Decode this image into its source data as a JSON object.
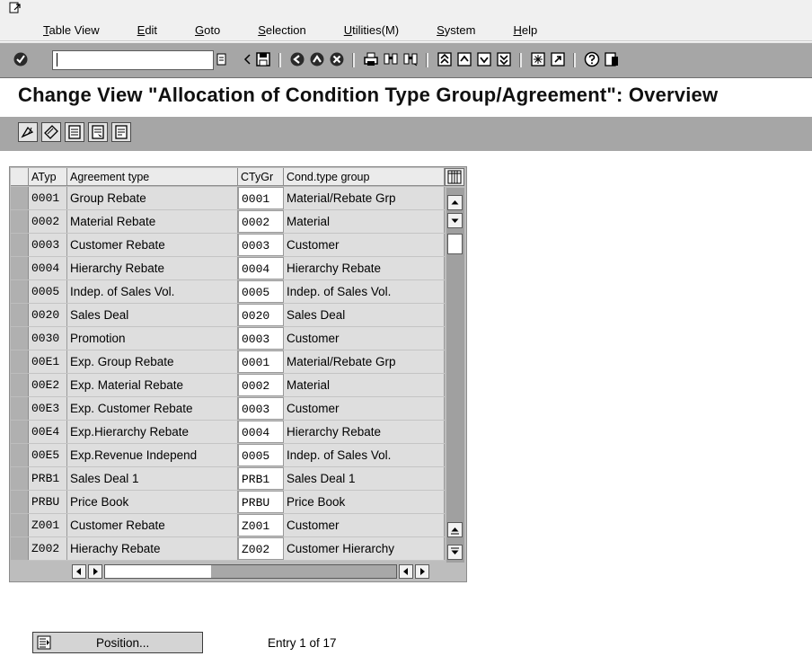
{
  "menu": {
    "items": [
      {
        "pre": "",
        "u": "T",
        "post": "able View"
      },
      {
        "pre": "",
        "u": "E",
        "post": "dit"
      },
      {
        "pre": "",
        "u": "G",
        "post": "oto"
      },
      {
        "pre": "",
        "u": "S",
        "post": "election"
      },
      {
        "pre": "",
        "u": "U",
        "post": "tilities(M)"
      },
      {
        "pre": "",
        "u": "S",
        "post": "ystem"
      },
      {
        "pre": "",
        "u": "H",
        "post": "elp"
      }
    ]
  },
  "command_field": {
    "value": ""
  },
  "title": "Change View \"Allocation of Condition Type Group/Agreement\": Overview",
  "table": {
    "headers": [
      "ATyp",
      "Agreement type",
      "CTyGr",
      "Cond.type group"
    ],
    "rows": [
      [
        "0001",
        "Group Rebate",
        "0001",
        "Material/Rebate Grp"
      ],
      [
        "0002",
        "Material Rebate",
        "0002",
        "Material"
      ],
      [
        "0003",
        "Customer Rebate",
        "0003",
        "Customer"
      ],
      [
        "0004",
        "Hierarchy Rebate",
        "0004",
        "Hierarchy Rebate"
      ],
      [
        "0005",
        "Indep. of Sales Vol.",
        "0005",
        "Indep. of Sales Vol."
      ],
      [
        "0020",
        "Sales Deal",
        "0020",
        "Sales Deal"
      ],
      [
        "0030",
        "Promotion",
        "0003",
        "Customer"
      ],
      [
        "00E1",
        "Exp. Group Rebate",
        "0001",
        "Material/Rebate Grp"
      ],
      [
        "00E2",
        "Exp. Material Rebate",
        "0002",
        "Material"
      ],
      [
        "00E3",
        "Exp. Customer Rebate",
        "0003",
        "Customer"
      ],
      [
        "00E4",
        "Exp.Hierarchy Rebate",
        "0004",
        "Hierarchy Rebate"
      ],
      [
        "00E5",
        "Exp.Revenue Independ",
        "0005",
        "Indep. of Sales Vol."
      ],
      [
        "PRB1",
        "Sales Deal 1",
        "PRB1",
        "Sales Deal 1"
      ],
      [
        "PRBU",
        "Price Book",
        "PRBU",
        "Price Book"
      ],
      [
        "Z001",
        "Customer Rebate",
        "Z001",
        "Customer"
      ],
      [
        "Z002",
        "Hierachy Rebate",
        "Z002",
        "Customer Hierarchy"
      ]
    ]
  },
  "footer": {
    "position_label": "Position...",
    "entry_text": "Entry 1 of 17"
  },
  "colors": {
    "toolbar_bg": "#a6a6a6",
    "menubar_bg": "#f0f0f0",
    "table_bg": "#bdbdbd"
  }
}
